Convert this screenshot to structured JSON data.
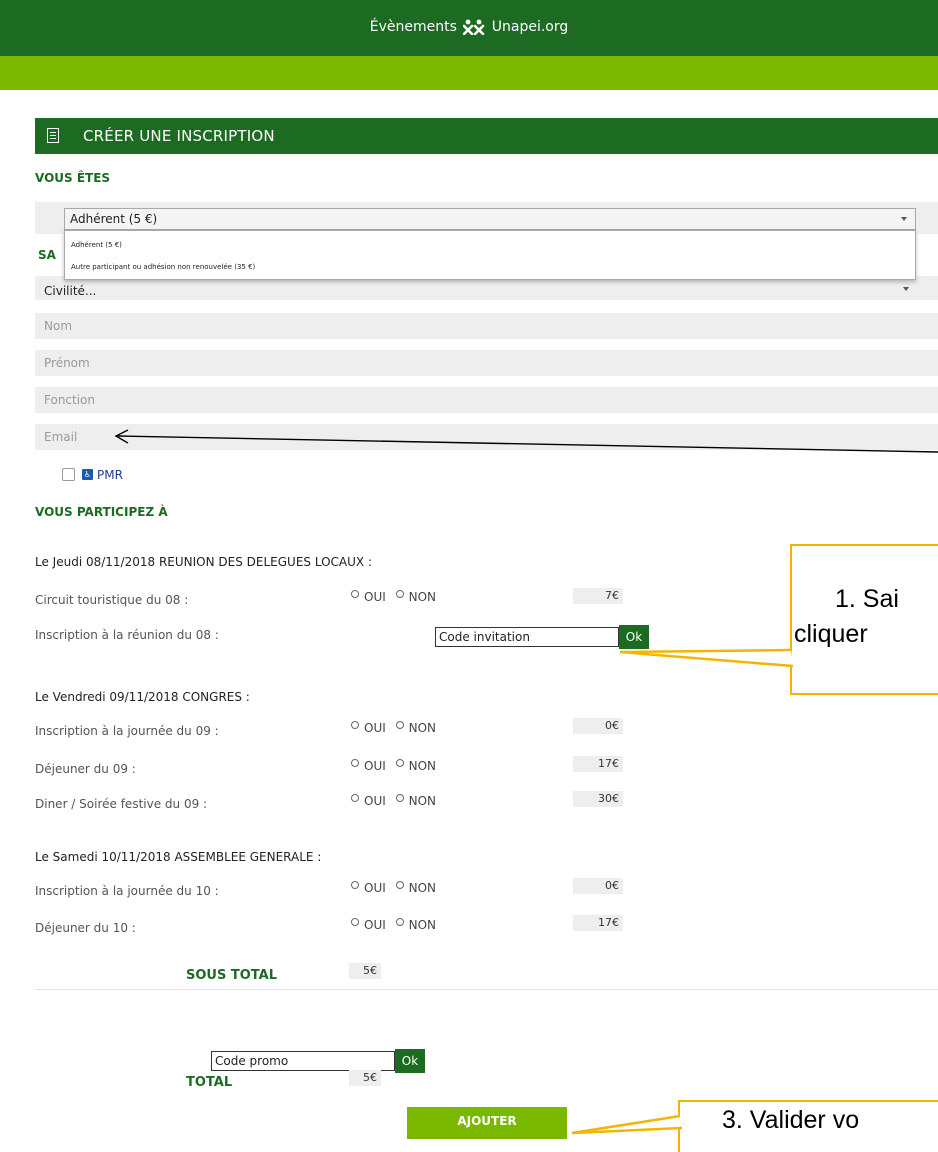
{
  "header": {
    "brand_prefix": "Évènements",
    "brand_name": "Unapei",
    "brand_suffix": ".org"
  },
  "section": {
    "title": "CRÉER UNE INSCRIPTION"
  },
  "vous_etes": {
    "label": "VOUS ÊTES",
    "selected": "Adhérent (5 €)",
    "options": [
      "Adhérent (5 €)",
      "Autre participant ou adhésion non renouvelée (35 €)"
    ]
  },
  "personal": {
    "section_partial": "SA",
    "civilite": "Civilité...",
    "nom_placeholder": "Nom",
    "prenom_placeholder": "Prénom",
    "fonction_placeholder": "Fonction",
    "email_placeholder": "Email",
    "pmr_label": "PMR"
  },
  "participation": {
    "label": "VOUS PARTICIPEZ À",
    "oui": "OUI",
    "non": "NON",
    "days": [
      {
        "title": "Le Jeudi 08/11/2018 REUNION DES DELEGUES LOCAUX :",
        "items": [
          {
            "label": "Circuit touristique du 08 :",
            "price": "7€"
          },
          {
            "label": "Inscription à la réunion du 08 :",
            "code_placeholder": "Code invitation",
            "ok": "Ok"
          }
        ]
      },
      {
        "title": "Le Vendredi 09/11/2018 CONGRES :",
        "items": [
          {
            "label": "Inscription à la journée du 09 :",
            "price": "0€"
          },
          {
            "label": "Déjeuner du 09 :",
            "price": "17€"
          },
          {
            "label": "Diner / Soirée festive du 09 :",
            "price": "30€"
          }
        ]
      },
      {
        "title": "Le Samedi 10/11/2018 ASSEMBLEE GENERALE :",
        "items": [
          {
            "label": "Inscription à la journée du 10 :",
            "price": "0€"
          },
          {
            "label": "Déjeuner du 10 :",
            "price": "17€"
          }
        ]
      }
    ]
  },
  "totals": {
    "sous_total_label": "SOUS TOTAL",
    "sous_total": "5€",
    "promo_placeholder": "Code promo",
    "promo_ok": "Ok",
    "total_label": "TOTAL",
    "total": "5€",
    "add_button": "AJOUTER"
  },
  "annotations": {
    "callout1_line1": "1. Sai",
    "callout1_line2": "cliquer",
    "callout3": "3. Valider vo",
    "callout_color": "#f2b600"
  },
  "colors": {
    "dark_green": "#1d6b22",
    "light_green": "#7ab800"
  }
}
